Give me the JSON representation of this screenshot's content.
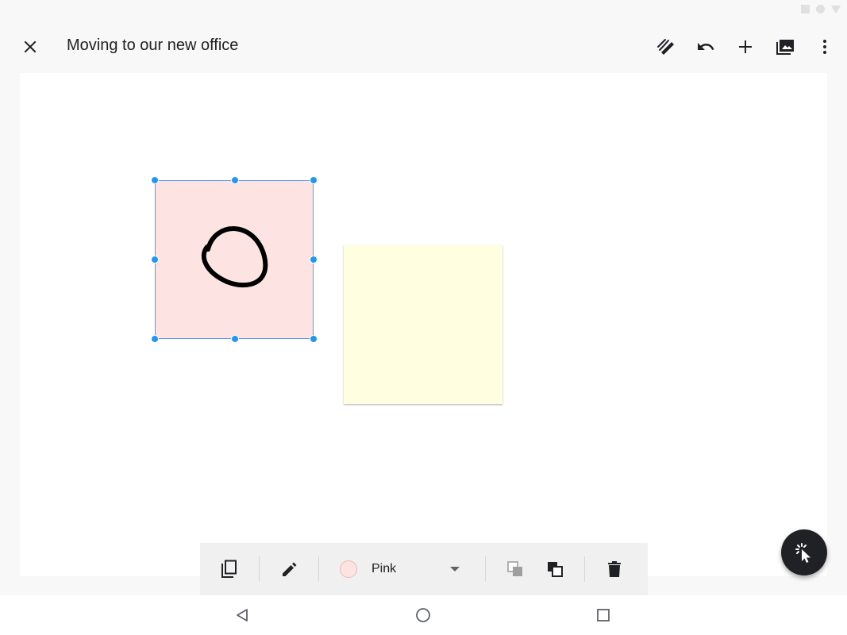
{
  "appbar": {
    "title": "Moving to our new office",
    "close_icon": "close-icon",
    "actions": [
      "pen-stylus-icon",
      "undo-icon",
      "add-icon",
      "image-gallery-icon",
      "more-vert-icon"
    ]
  },
  "canvas": {
    "notes": [
      {
        "color_name": "Pink",
        "color": "#fde4e2",
        "selected": true,
        "content": "ink-circle-drawing"
      },
      {
        "color_name": "Yellow",
        "color": "#fffee0",
        "selected": false,
        "content": ""
      }
    ]
  },
  "toolbar": {
    "duplicate_icon": "duplicate-icon",
    "edit_icon": "pencil-icon",
    "color": {
      "label": "Pink",
      "swatch": "#fde4e2"
    },
    "send_backward_icon": "send-backward-icon",
    "bring_forward_icon": "bring-forward-icon",
    "delete_icon": "delete-icon"
  },
  "fab": {
    "icon": "select-pointer-icon"
  },
  "navbar": {
    "items": [
      "back-icon",
      "home-icon",
      "recents-icon"
    ]
  },
  "colors": {
    "accent": "#2196f3",
    "selection": "#5e97f6",
    "fab_bg": "#202124"
  }
}
